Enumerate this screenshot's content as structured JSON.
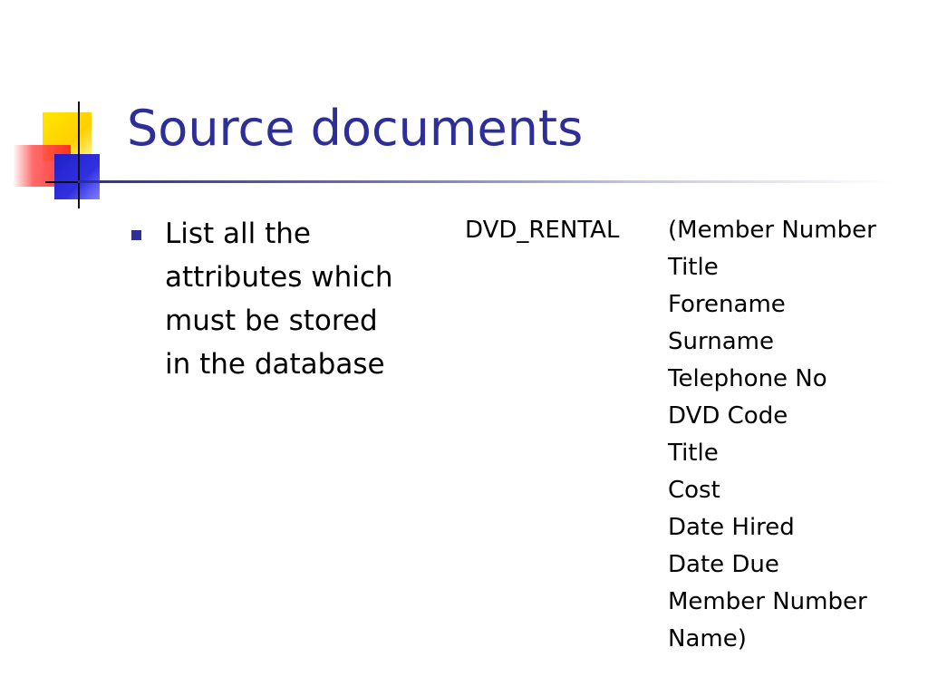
{
  "slide": {
    "title": "Source documents",
    "bullet": {
      "text": "List all the\nattributes which\nmust be stored\nin the database"
    },
    "entity": {
      "name": "DVD_RENTAL",
      "attributes": [
        "(Member Number",
        "Title",
        "Forename",
        "Surname",
        "Telephone No",
        "DVD Code",
        "Title",
        "Cost",
        "Date Hired",
        "Date Due",
        "Member Number",
        "Name)"
      ]
    }
  },
  "colors": {
    "title": "#2e2e99",
    "bullet": "#2e2e99",
    "accent_yellow": "#ffe600",
    "accent_red": "#ff2020",
    "accent_blue": "#2020c8"
  }
}
